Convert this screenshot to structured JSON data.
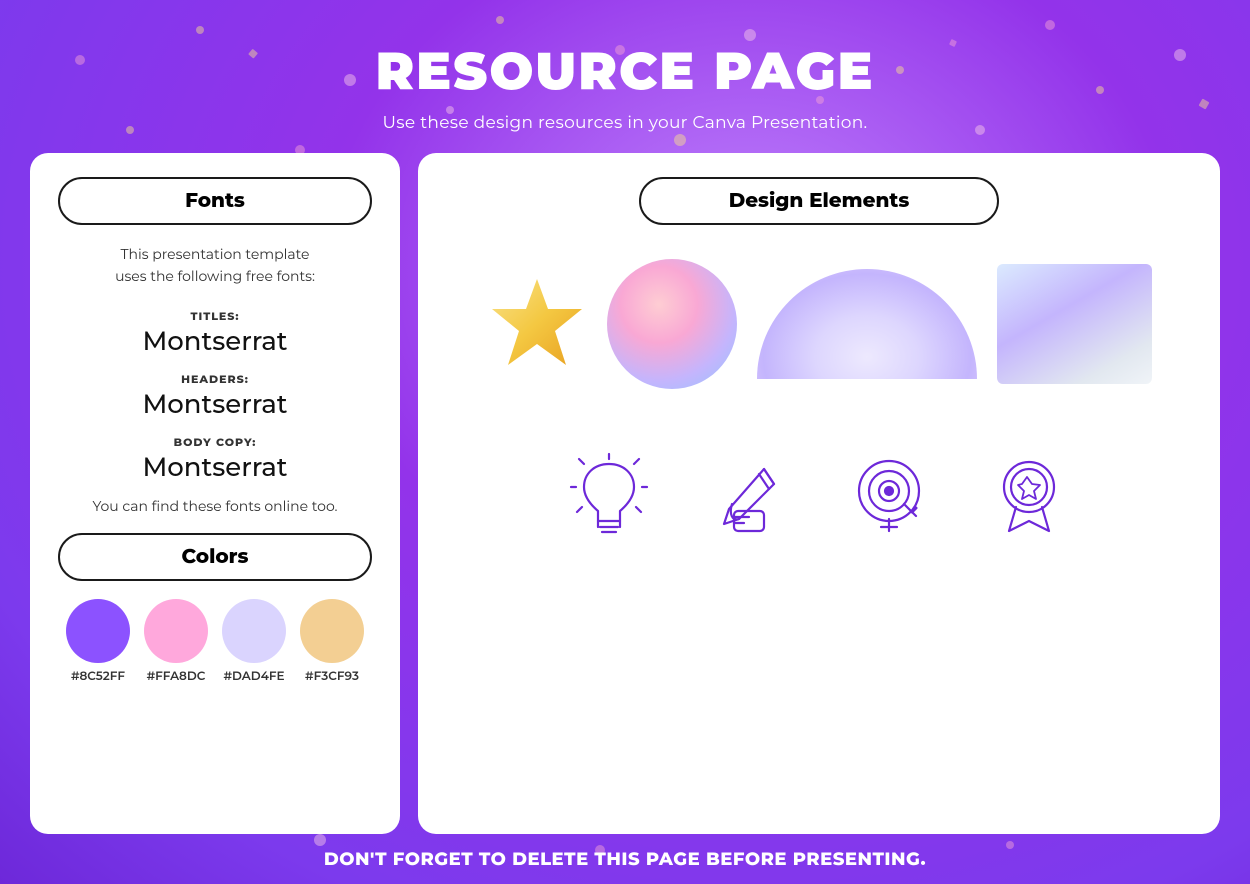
{
  "header": {
    "title": "RESOURCE PAGE",
    "subtitle": "Use these design resources in your Canva Presentation."
  },
  "left_panel": {
    "fonts_header": "Fonts",
    "fonts_description": "This presentation template\nuses the following free fonts:",
    "font_entries": [
      {
        "label": "TITLES:",
        "name": "Montserrat"
      },
      {
        "label": "HEADERS:",
        "name": "Montserrat"
      },
      {
        "label": "BODY COPY:",
        "name": "Montserrat"
      }
    ],
    "fonts_note": "You can find these fonts online too.",
    "colors_header": "Colors",
    "colors": [
      {
        "hex": "#8C52FF",
        "label": "#8C52FF"
      },
      {
        "hex": "#FFA8DC",
        "label": "#FFA8DC"
      },
      {
        "hex": "#DAD4FE",
        "label": "#DAD4FE"
      },
      {
        "hex": "#F3CF93",
        "label": "#F3CF93"
      }
    ]
  },
  "right_panel": {
    "design_elements_header": "Design Elements",
    "shapes": [
      "star",
      "circle",
      "semicircle",
      "square"
    ],
    "icons": [
      "lightbulb",
      "pencil-hand",
      "target",
      "award"
    ]
  },
  "footer": {
    "text": "DON'T FORGET TO DELETE THIS PAGE BEFORE PRESENTING."
  }
}
